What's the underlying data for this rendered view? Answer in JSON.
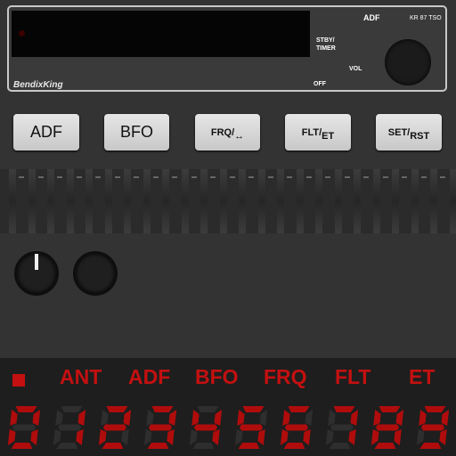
{
  "radio": {
    "brand": "BendixKing",
    "model": "KR 87 TSO",
    "mode": "ADF",
    "stby_timer": [
      "STBY/",
      "TIMER"
    ],
    "vol": "VOL",
    "off": "OFF"
  },
  "buttons": {
    "adf": "ADF",
    "bfo": "BFO",
    "frq": "FRQ/",
    "frq_arrow": "↔",
    "flt": "FLT/",
    "flt_sub": "ET",
    "set": "SET/",
    "set_sub": "RST"
  },
  "annunciators": [
    "ANT",
    "ADF",
    "BFO",
    "FRQ",
    "FLT",
    "ET"
  ],
  "digits": [
    "0",
    "1",
    "2",
    "3",
    "4",
    "5",
    "6",
    "7",
    "8",
    "9"
  ],
  "colors": {
    "background": "#333333",
    "annunciator": "#c41010",
    "segment_on": "#b00c0c",
    "segment_off": "#2e2e2e"
  }
}
